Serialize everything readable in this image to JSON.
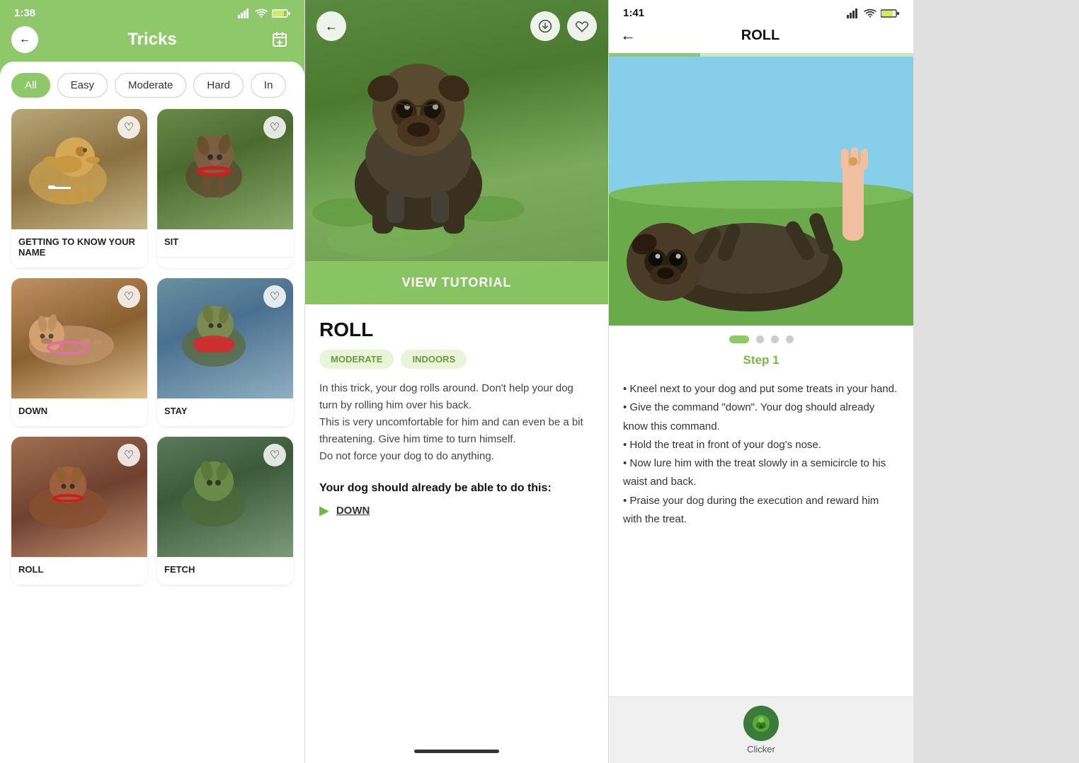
{
  "panel1": {
    "statusBar": {
      "time": "1:38"
    },
    "title": "Tricks",
    "backBtn": "←",
    "addBtn": "🗓",
    "filters": [
      {
        "label": "All",
        "active": true
      },
      {
        "label": "Easy",
        "active": false
      },
      {
        "label": "Moderate",
        "active": false
      },
      {
        "label": "Hard",
        "active": false
      },
      {
        "label": "In",
        "active": false
      }
    ],
    "tricks": [
      {
        "id": "getting-to-know",
        "label": "GETTING TO KNOW YOUR NAME",
        "dogStyle": "dog-golden"
      },
      {
        "id": "sit",
        "label": "SIT",
        "dogStyle": "dog-shepherd"
      },
      {
        "id": "down",
        "label": "DOWN",
        "dogStyle": "dog-collie"
      },
      {
        "id": "stay",
        "label": "STAY",
        "dogStyle": "dog-stay"
      },
      {
        "id": "bottom1",
        "label": "ROLL",
        "dogStyle": "dog-bottom1"
      },
      {
        "id": "bottom2",
        "label": "FETCH",
        "dogStyle": "dog-bottom2"
      }
    ]
  },
  "panel2": {
    "title": "ROLL",
    "backBtn": "←",
    "downloadIcon": "⬇",
    "heartIcon": "♡",
    "viewTutorialBtn": "VIEW TUTORIAL",
    "tags": [
      {
        "label": "MODERATE",
        "style": "moderate"
      },
      {
        "label": "INDOORS",
        "style": "indoors"
      }
    ],
    "description": "In this trick, your dog rolls around. Don't help your dog turn by rolling him over his back.\nThis is very uncomfortable for him and can even be a bit threatening. Give him time to turn himself.\nDo not force your dog to do anything.",
    "prereqTitle": "Your dog should already be able to do this:",
    "prereqItems": [
      {
        "label": "DOWN"
      }
    ]
  },
  "panel3": {
    "statusBar": {
      "time": "1:41"
    },
    "title": "ROLL",
    "backBtn": "←",
    "stepLabel": "Step 1",
    "steps": [
      {
        "active": true
      },
      {
        "active": false
      },
      {
        "active": false
      },
      {
        "active": false
      }
    ],
    "stepText": "• Kneel next to your dog and put some treats in your hand.\n• Give the command \"down\". Your dog should already know this command.\n• Hold the treat in front of your dog's nose.\n• Now lure him with the treat slowly in a semicircle to his waist and back.\n• Praise your dog during the execution and reward him with the treat.",
    "clickerLabel": "Clicker",
    "clickerIcon": "🐾"
  }
}
